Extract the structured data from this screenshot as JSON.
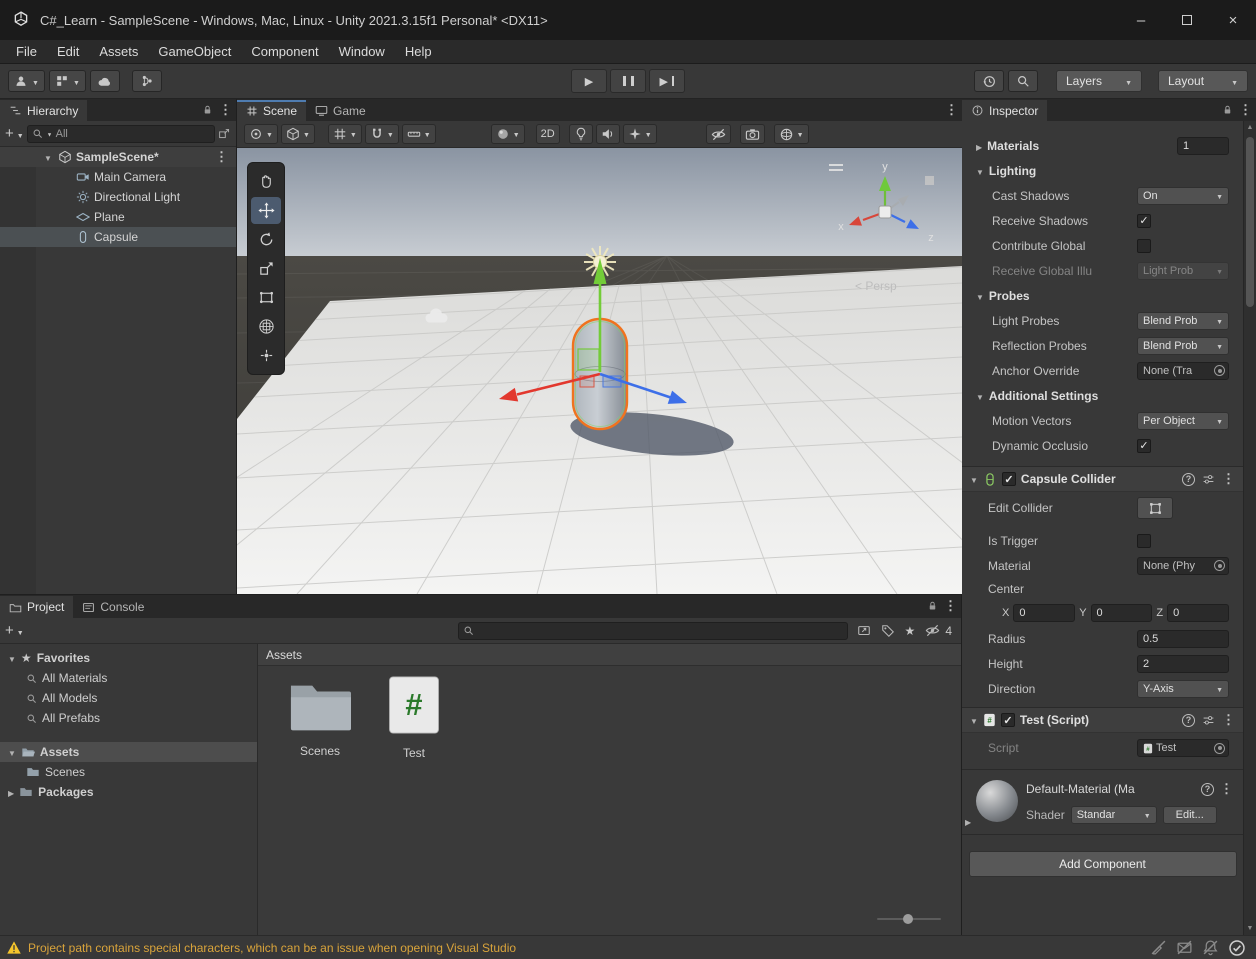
{
  "window": {
    "title": "C#_Learn - SampleScene - Windows, Mac, Linux - Unity 2021.3.15f1 Personal* <DX11>"
  },
  "colors": {
    "selection_outline": "#F0731E",
    "warning_text": "#D9A43B",
    "axis_x": "#E2382E",
    "axis_y": "#73CC38",
    "axis_z": "#3D6FE8"
  },
  "menu": {
    "items": [
      "File",
      "Edit",
      "Assets",
      "GameObject",
      "Component",
      "Window",
      "Help"
    ]
  },
  "toolbar": {
    "layers": "Layers",
    "layout": "Layout"
  },
  "hierarchy": {
    "tab": "Hierarchy",
    "search_value": "All",
    "scene_row": "SampleScene*",
    "items": [
      "Main Camera",
      "Directional Light",
      "Plane",
      "Capsule"
    ]
  },
  "scene_view": {
    "tabs": {
      "scene": "Scene",
      "game": "Game"
    },
    "toolbar": {
      "two_d": "2D"
    },
    "persp_label": "< Persp",
    "axes": {
      "x": "x",
      "y": "y",
      "z": "z"
    }
  },
  "inspector": {
    "tab": "Inspector",
    "materials": {
      "label": "Materials",
      "value": "1"
    },
    "lighting": {
      "header": "Lighting",
      "cast_shadows": {
        "label": "Cast Shadows",
        "value": "On"
      },
      "receive_shadows": {
        "label": "Receive Shadows",
        "checked": true
      },
      "contribute_global": {
        "label": "Contribute Global",
        "checked": false
      },
      "receive_gi": {
        "label": "Receive Global Illu",
        "value": "Light Prob"
      }
    },
    "probes": {
      "header": "Probes",
      "light_probes": {
        "label": "Light Probes",
        "value": "Blend Prob"
      },
      "reflection_probes": {
        "label": "Reflection Probes",
        "value": "Blend Prob"
      },
      "anchor_override": {
        "label": "Anchor Override",
        "value": "None (Tra"
      }
    },
    "additional": {
      "header": "Additional Settings",
      "motion_vectors": {
        "label": "Motion Vectors",
        "value": "Per Object"
      },
      "dynamic_occlusion": {
        "label": "Dynamic Occlusio",
        "checked": true
      }
    },
    "capsule_collider": {
      "title": "Capsule Collider",
      "edit_collider": "Edit Collider",
      "is_trigger": {
        "label": "Is Trigger",
        "checked": false
      },
      "material": {
        "label": "Material",
        "value": "None (Phy"
      },
      "center": {
        "label": "Center",
        "x_label": "X",
        "x": "0",
        "y_label": "Y",
        "y": "0",
        "z_label": "Z",
        "z": "0"
      },
      "radius": {
        "label": "Radius",
        "value": "0.5"
      },
      "height": {
        "label": "Height",
        "value": "2"
      },
      "direction": {
        "label": "Direction",
        "value": "Y-Axis"
      }
    },
    "test_script": {
      "title": "Test (Script)",
      "script_label": "Script",
      "script_value": "Test"
    },
    "material_footer": {
      "title": "Default-Material (Ma",
      "shader_label": "Shader",
      "shader_value": "Standar",
      "edit_button": "Edit..."
    },
    "add_component": "Add Component"
  },
  "project": {
    "tab_project": "Project",
    "tab_console": "Console",
    "favorites_header": "Favorites",
    "favorites": [
      "All Materials",
      "All Models",
      "All Prefabs"
    ],
    "assets_folder": "Assets",
    "scenes_folder": "Scenes",
    "packages_folder": "Packages",
    "pane_header": "Assets",
    "items": [
      {
        "label": "Scenes",
        "type": "folder"
      },
      {
        "label": "Test",
        "type": "script"
      }
    ],
    "hidden_count": "4"
  },
  "status_bar": {
    "message": "Project path contains special characters, which can be an issue when opening Visual Studio"
  }
}
